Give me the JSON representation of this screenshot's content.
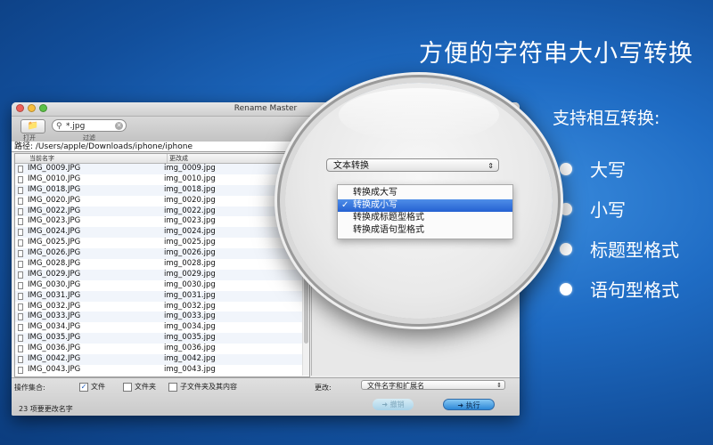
{
  "promo": {
    "headline": "方便的字符串大小写转换",
    "features_title": "支持相互转换:",
    "features": [
      "大写",
      "小写",
      "标题型格式",
      "语句型格式"
    ]
  },
  "window": {
    "title": "Rename Master",
    "toolbar": {
      "open_label": "打开",
      "filter_label": "过滤",
      "search_value": "*.jpg"
    },
    "path": "路径: /Users/apple/Downloads/iphone/iphone",
    "columns": [
      "当前名字",
      "更改成"
    ],
    "rows": [
      [
        "IMG_0009.JPG",
        "img_0009.jpg"
      ],
      [
        "IMG_0010.JPG",
        "img_0010.jpg"
      ],
      [
        "IMG_0018.JPG",
        "img_0018.jpg"
      ],
      [
        "IMG_0020.JPG",
        "img_0020.jpg"
      ],
      [
        "IMG_0022.JPG",
        "img_0022.jpg"
      ],
      [
        "IMG_0023.JPG",
        "img_0023.jpg"
      ],
      [
        "IMG_0024.JPG",
        "img_0024.jpg"
      ],
      [
        "IMG_0025.JPG",
        "img_0025.jpg"
      ],
      [
        "IMG_0026.JPG",
        "img_0026.jpg"
      ],
      [
        "IMG_0028.JPG",
        "img_0028.jpg"
      ],
      [
        "IMG_0029.JPG",
        "img_0029.jpg"
      ],
      [
        "IMG_0030.JPG",
        "img_0030.jpg"
      ],
      [
        "IMG_0031.JPG",
        "img_0031.jpg"
      ],
      [
        "IMG_0032.JPG",
        "img_0032.jpg"
      ],
      [
        "IMG_0033.JPG",
        "img_0033.jpg"
      ],
      [
        "IMG_0034.JPG",
        "img_0034.jpg"
      ],
      [
        "IMG_0035.JPG",
        "img_0035.jpg"
      ],
      [
        "IMG_0036.JPG",
        "img_0036.jpg"
      ],
      [
        "IMG_0042.JPG",
        "img_0042.jpg"
      ],
      [
        "IMG_0043.JPG",
        "img_0043.jpg"
      ]
    ],
    "bottom": {
      "ops_label": "操作集合:",
      "checkboxes": [
        {
          "label": "文件",
          "checked": true
        },
        {
          "label": "文件夹",
          "checked": false
        },
        {
          "label": "子文件夹及其内容",
          "checked": false
        }
      ],
      "change_label": "更改:",
      "change_value": "文件名字和扩展名",
      "status": "23 项要更改名字",
      "undo_label": "撤销",
      "exec_label": "执行"
    }
  },
  "lens": {
    "select_value": "文本转换",
    "menu": [
      {
        "label": "转换成大写",
        "selected": false
      },
      {
        "label": "转换成小写",
        "selected": true
      },
      {
        "label": "转换成标题型格式",
        "selected": false
      },
      {
        "label": "转换成语句型格式",
        "selected": false
      }
    ],
    "colors": {
      "selection": "#2461d2",
      "background_blue": "#1f6cc4"
    }
  }
}
